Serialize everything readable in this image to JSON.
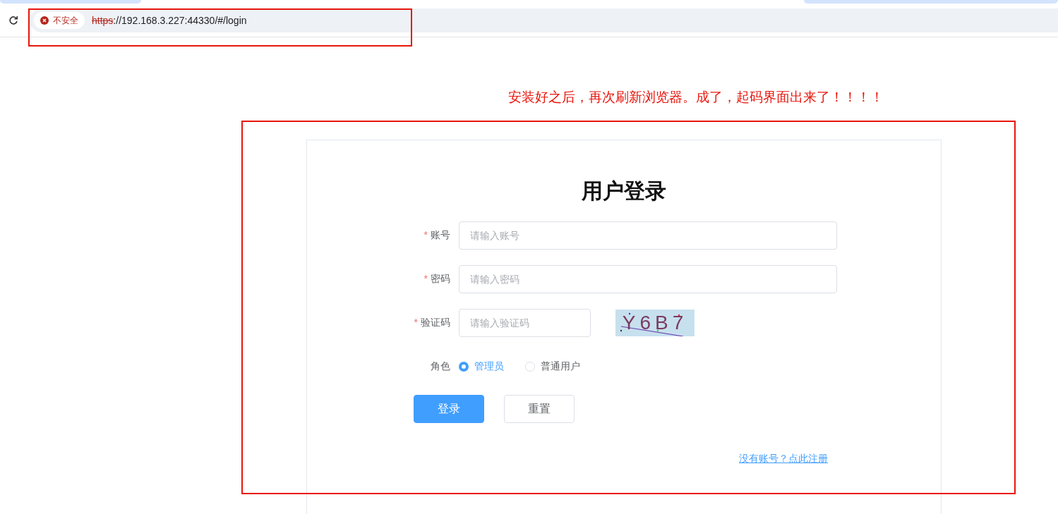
{
  "browser": {
    "security_label": "不安全",
    "url_scheme": "https",
    "url_rest": "://192.168.3.227:44330/#/login"
  },
  "annotation": "安装好之后，再次刷新浏览器。成了，起码界面出来了！！！！",
  "login": {
    "title": "用户登录",
    "fields": [
      {
        "kind": "text",
        "label": "账号",
        "required_mark": "*",
        "placeholder": "请输入账号"
      },
      {
        "kind": "text",
        "label": "密码",
        "required_mark": "*",
        "placeholder": "请输入密码"
      },
      {
        "kind": "captcha",
        "label": "验证码",
        "required_mark": "*",
        "placeholder": "请输入验证码",
        "captcha_text": "Y6B7"
      }
    ],
    "role": {
      "label": "角色",
      "options": [
        {
          "label": "管理员",
          "selected": true
        },
        {
          "label": "普通用户",
          "selected": false
        }
      ]
    },
    "buttons": [
      {
        "label": "登录",
        "kind": "primary"
      },
      {
        "label": "重置",
        "kind": "default"
      }
    ],
    "register_link": "没有账号？点此注册"
  }
}
